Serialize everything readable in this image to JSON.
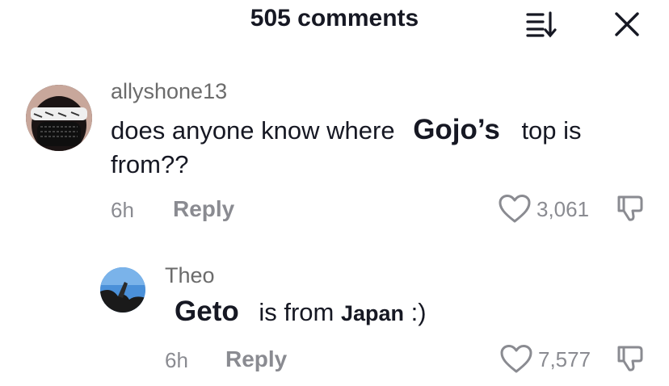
{
  "header": {
    "title": "505 comments",
    "icons": {
      "sort": "sort-descending-icon",
      "close": "close-icon"
    }
  },
  "comments": [
    {
      "username": "allyshone13",
      "text_before": "does anyone know where",
      "emphasis": "Gojo’s",
      "text_after": "top is",
      "text_line2": "from??",
      "time": "6h",
      "reply_label": "Reply",
      "likes": "3,061"
    },
    {
      "username": "Theo",
      "emphasis": "Geto",
      "text_middle": "is from",
      "emphasis2": "Japan",
      "text_after": ":)",
      "time": "6h",
      "reply_label": "Reply",
      "likes": "7,577"
    }
  ],
  "colors": {
    "text": "#161823",
    "secondary": "#8a8b91",
    "username": "#6b6b6b",
    "background": "#ffffff"
  }
}
